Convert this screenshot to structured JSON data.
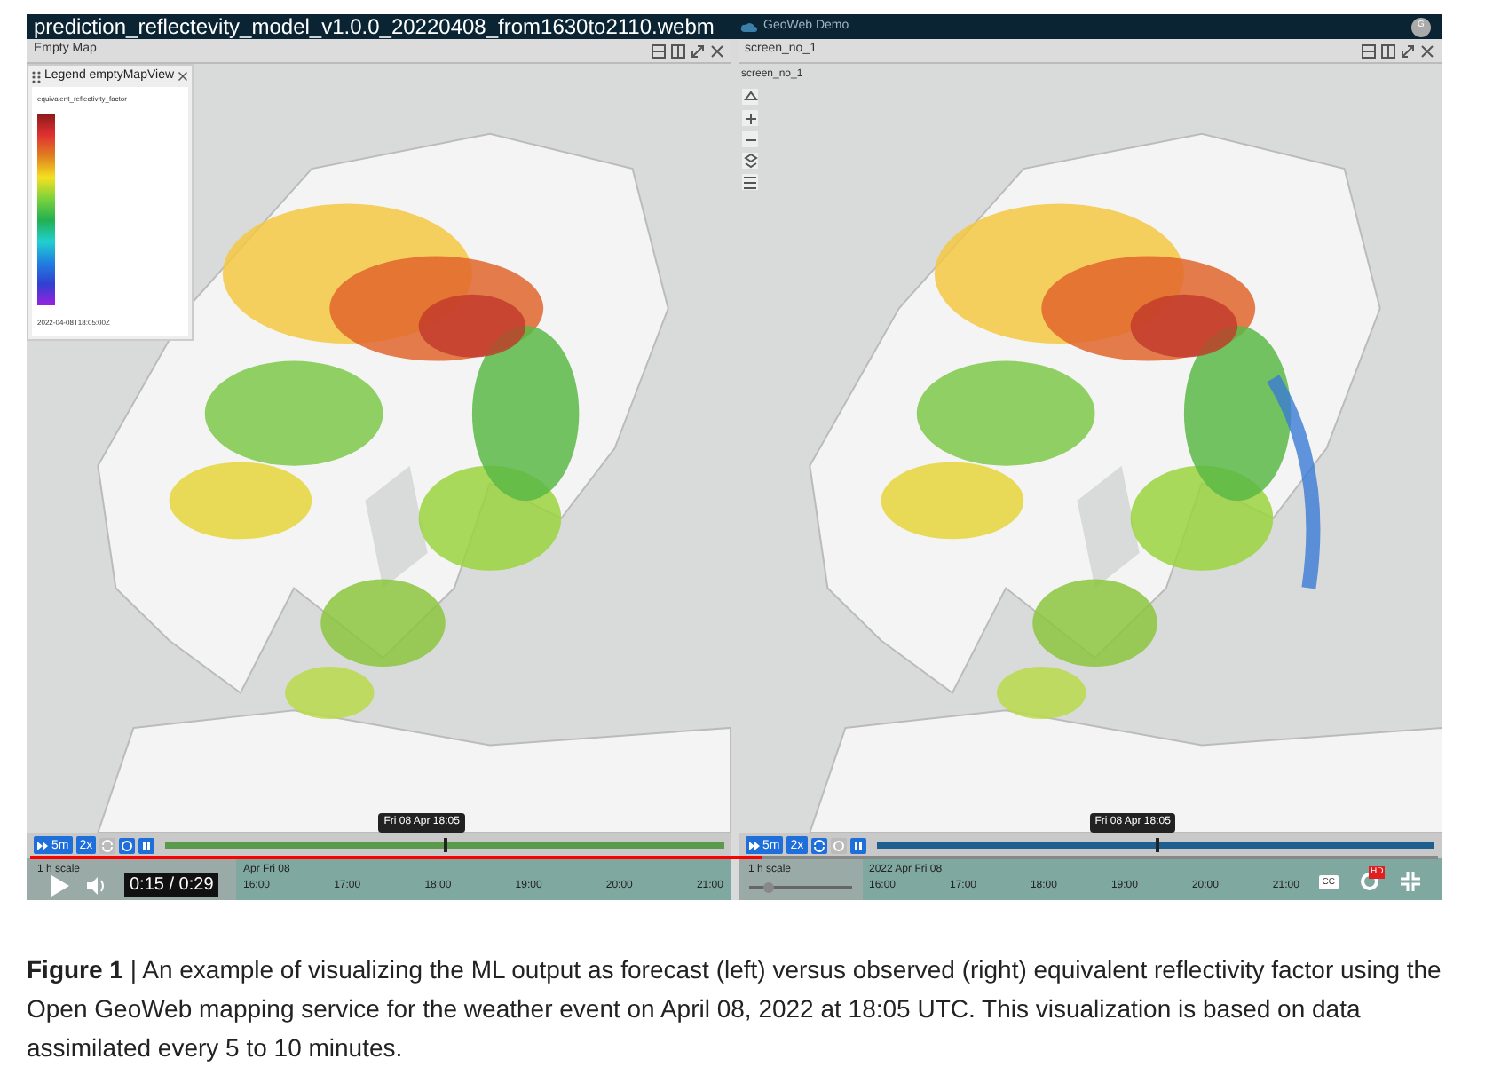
{
  "video": {
    "title": "prediction_reflectevity_model_v1.0.0_20220408_from1630to2110.webm",
    "time": "0:15 / 0:29",
    "progress": {
      "level": 0.52
    },
    "cc": "CC",
    "hd": "HD"
  },
  "app": {
    "name": "GeoWeb Demo",
    "avatar": "G"
  },
  "panels": [
    {
      "title": "Empty Map",
      "legend": {
        "title": "Legend emptyMapView",
        "variable": "equivalent_reflectivity_factor",
        "time": "2022-04-08T18:05:00Z"
      },
      "timeline": {
        "step": "5m",
        "speed": "2x",
        "tooltip": "Fri 08 Apr 18:05",
        "time_slider": {
          "level": 0.5
        },
        "scale": "1 h scale",
        "date": "Apr Fri 08",
        "hours": [
          "16:00",
          "17:00",
          "18:00",
          "19:00",
          "20:00",
          "21:00"
        ]
      }
    },
    {
      "title": "screen_no_1",
      "map_label": "screen_no_1",
      "timeline": {
        "step": "5m",
        "speed": "2x",
        "tooltip": "Fri 08 Apr 18:05",
        "time_slider": {
          "level": 0.5
        },
        "scale": "1 h scale",
        "scale_slider": {
          "level": 0.15
        },
        "date": "2022 Apr Fri 08",
        "hours": [
          "16:00",
          "17:00",
          "18:00",
          "19:00",
          "20:00",
          "21:00"
        ]
      }
    }
  ],
  "caption": "**Figure 1** | An example of visualizing the ML output as forecast (left) versus observed (right) equivalent reflectivity factor using the Open GeoWeb mapping service for the weather event on April 08, 2022 at 18:05 UTC. This visualization is based on data assimilated every 5 to 10 minutes."
}
